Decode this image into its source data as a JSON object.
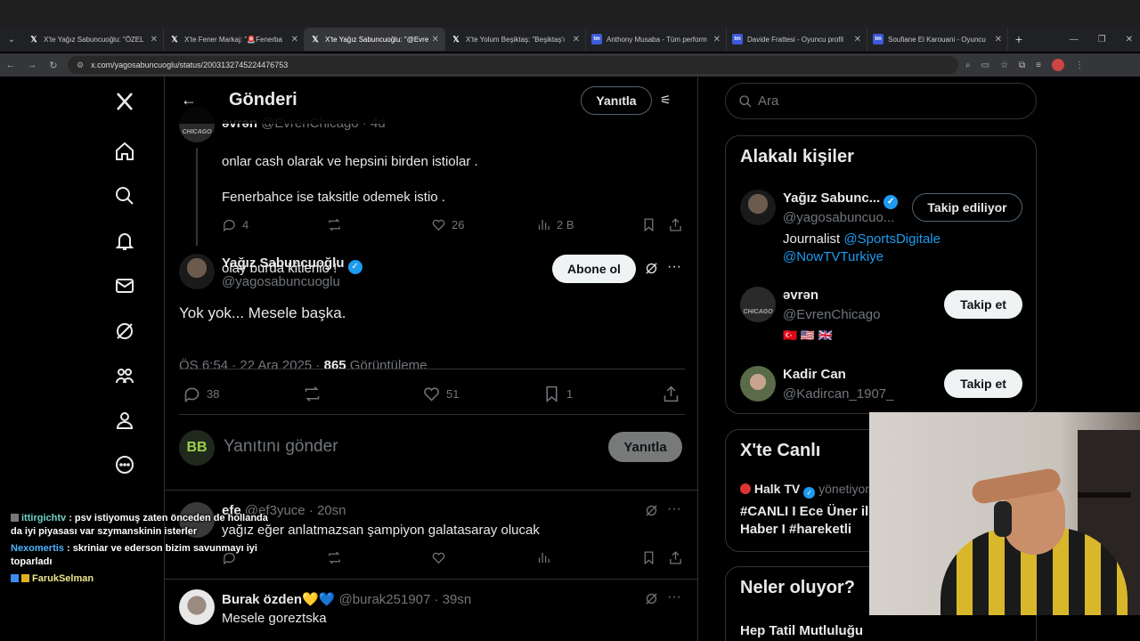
{
  "browser": {
    "tabs": [
      {
        "title": "X'te Yağız Sabuncuoğlu: \"ÖZEL",
        "favicon": "X",
        "active": false
      },
      {
        "title": "X'te Fener Markaj: \"🚨Fenerba",
        "favicon": "X",
        "active": false
      },
      {
        "title": "X'te Yağız Sabuncuoğlu: \"@Evre",
        "favicon": "X",
        "active": true
      },
      {
        "title": "X'te Yolum Beşiktaş: \"Beşiktaş'ı",
        "favicon": "X",
        "active": false
      },
      {
        "title": "Anthony Musaba - Tüm perform",
        "favicon": "tm",
        "active": false
      },
      {
        "title": "Davide Frattesi - Oyuncu profil",
        "favicon": "tm",
        "active": false
      },
      {
        "title": "Soufiane El Karouani - Oyuncu",
        "favicon": "tm",
        "active": false
      }
    ],
    "url": "x.com/yagosabuncuoglu/status/2003132745224476753"
  },
  "header": {
    "title": "Gönderi",
    "reply_label": "Yanıtla"
  },
  "prev_tweet": {
    "name": "əvrən",
    "handle": "@EvrenChicago · 4d",
    "text_line1": "onlar cash olarak ve hepsini birden istiolar .",
    "text_line2": "Fenerbahce ise taksitle odemek istio .",
    "text_line3": "olay burda kitlenio  !",
    "replies": "4",
    "likes": "26",
    "views": "2 B",
    "avatar_text": "əvrən CHICAGO"
  },
  "main_tweet": {
    "name": "Yağız Sabuncuoğlu",
    "handle": "@yagosabuncuoglu",
    "subscribe_label": "Abone ol",
    "text": "Yok yok... Mesele başka.",
    "time": "ÖS 6:54 · 22 Ara 2025 · ",
    "views_count": "865",
    "views_label": " Görüntüleme",
    "replies": "38",
    "likes": "51",
    "bookmarks": "1"
  },
  "reply_box": {
    "placeholder": "Yanıtını gönder",
    "button": "Yanıtla"
  },
  "replies": [
    {
      "name": "efe",
      "handle": "@ef3yuce · 20sn",
      "text": "yağız eğer anlatmazsan şampiyon galatasaray olucak"
    },
    {
      "name": "Burak özden💛💙",
      "handle": "@burak251907 · 39sn",
      "text": "Mesele goreztska"
    }
  ],
  "right": {
    "search_placeholder": "Ara",
    "related_title": "Alakalı kişiler",
    "people": [
      {
        "name": "Yağız Sabunc...",
        "handle": "@yagosabuncuo...",
        "button": "Takip ediliyor",
        "bio_prefix": "Journalist ",
        "bio_link1": "@SportsDigitale",
        "bio_link2": "@NowTVTurkiye"
      },
      {
        "name": "əvrən",
        "handle": "@EvrenChicago",
        "button": "Takip et",
        "flags": "🇹🇷 🇺🇸 🇬🇧"
      },
      {
        "name": "Kadir Can",
        "handle": "@Kadircan_1907_",
        "button": "Takip et"
      }
    ],
    "live_title": "X'te Canlı",
    "live_host": "Halk TV",
    "live_role": "yönetiyor",
    "live_text_line1": "#CANLI I Ece Üner ile",
    "live_text_line2": "Haber I #hareketli",
    "trends_title": "Neler oluyor?",
    "trend1": "Hep Tatil Mutluluğu"
  },
  "chat": [
    {
      "user": "ittirgichtv",
      "text": ": psv istiyomuş zaten önceden de hollanda da iyi piyasası var szymanskinin isterler"
    },
    {
      "user": "Nexomertis",
      "text": ": skriniar ve ederson bizim savunmayı iyi toparladı"
    },
    {
      "user": "FarukSelman",
      "text": ""
    }
  ],
  "colors": {
    "accent": "#1d9bf0",
    "bg": "#000000",
    "border": "#2f3336",
    "muted": "#71767b"
  }
}
